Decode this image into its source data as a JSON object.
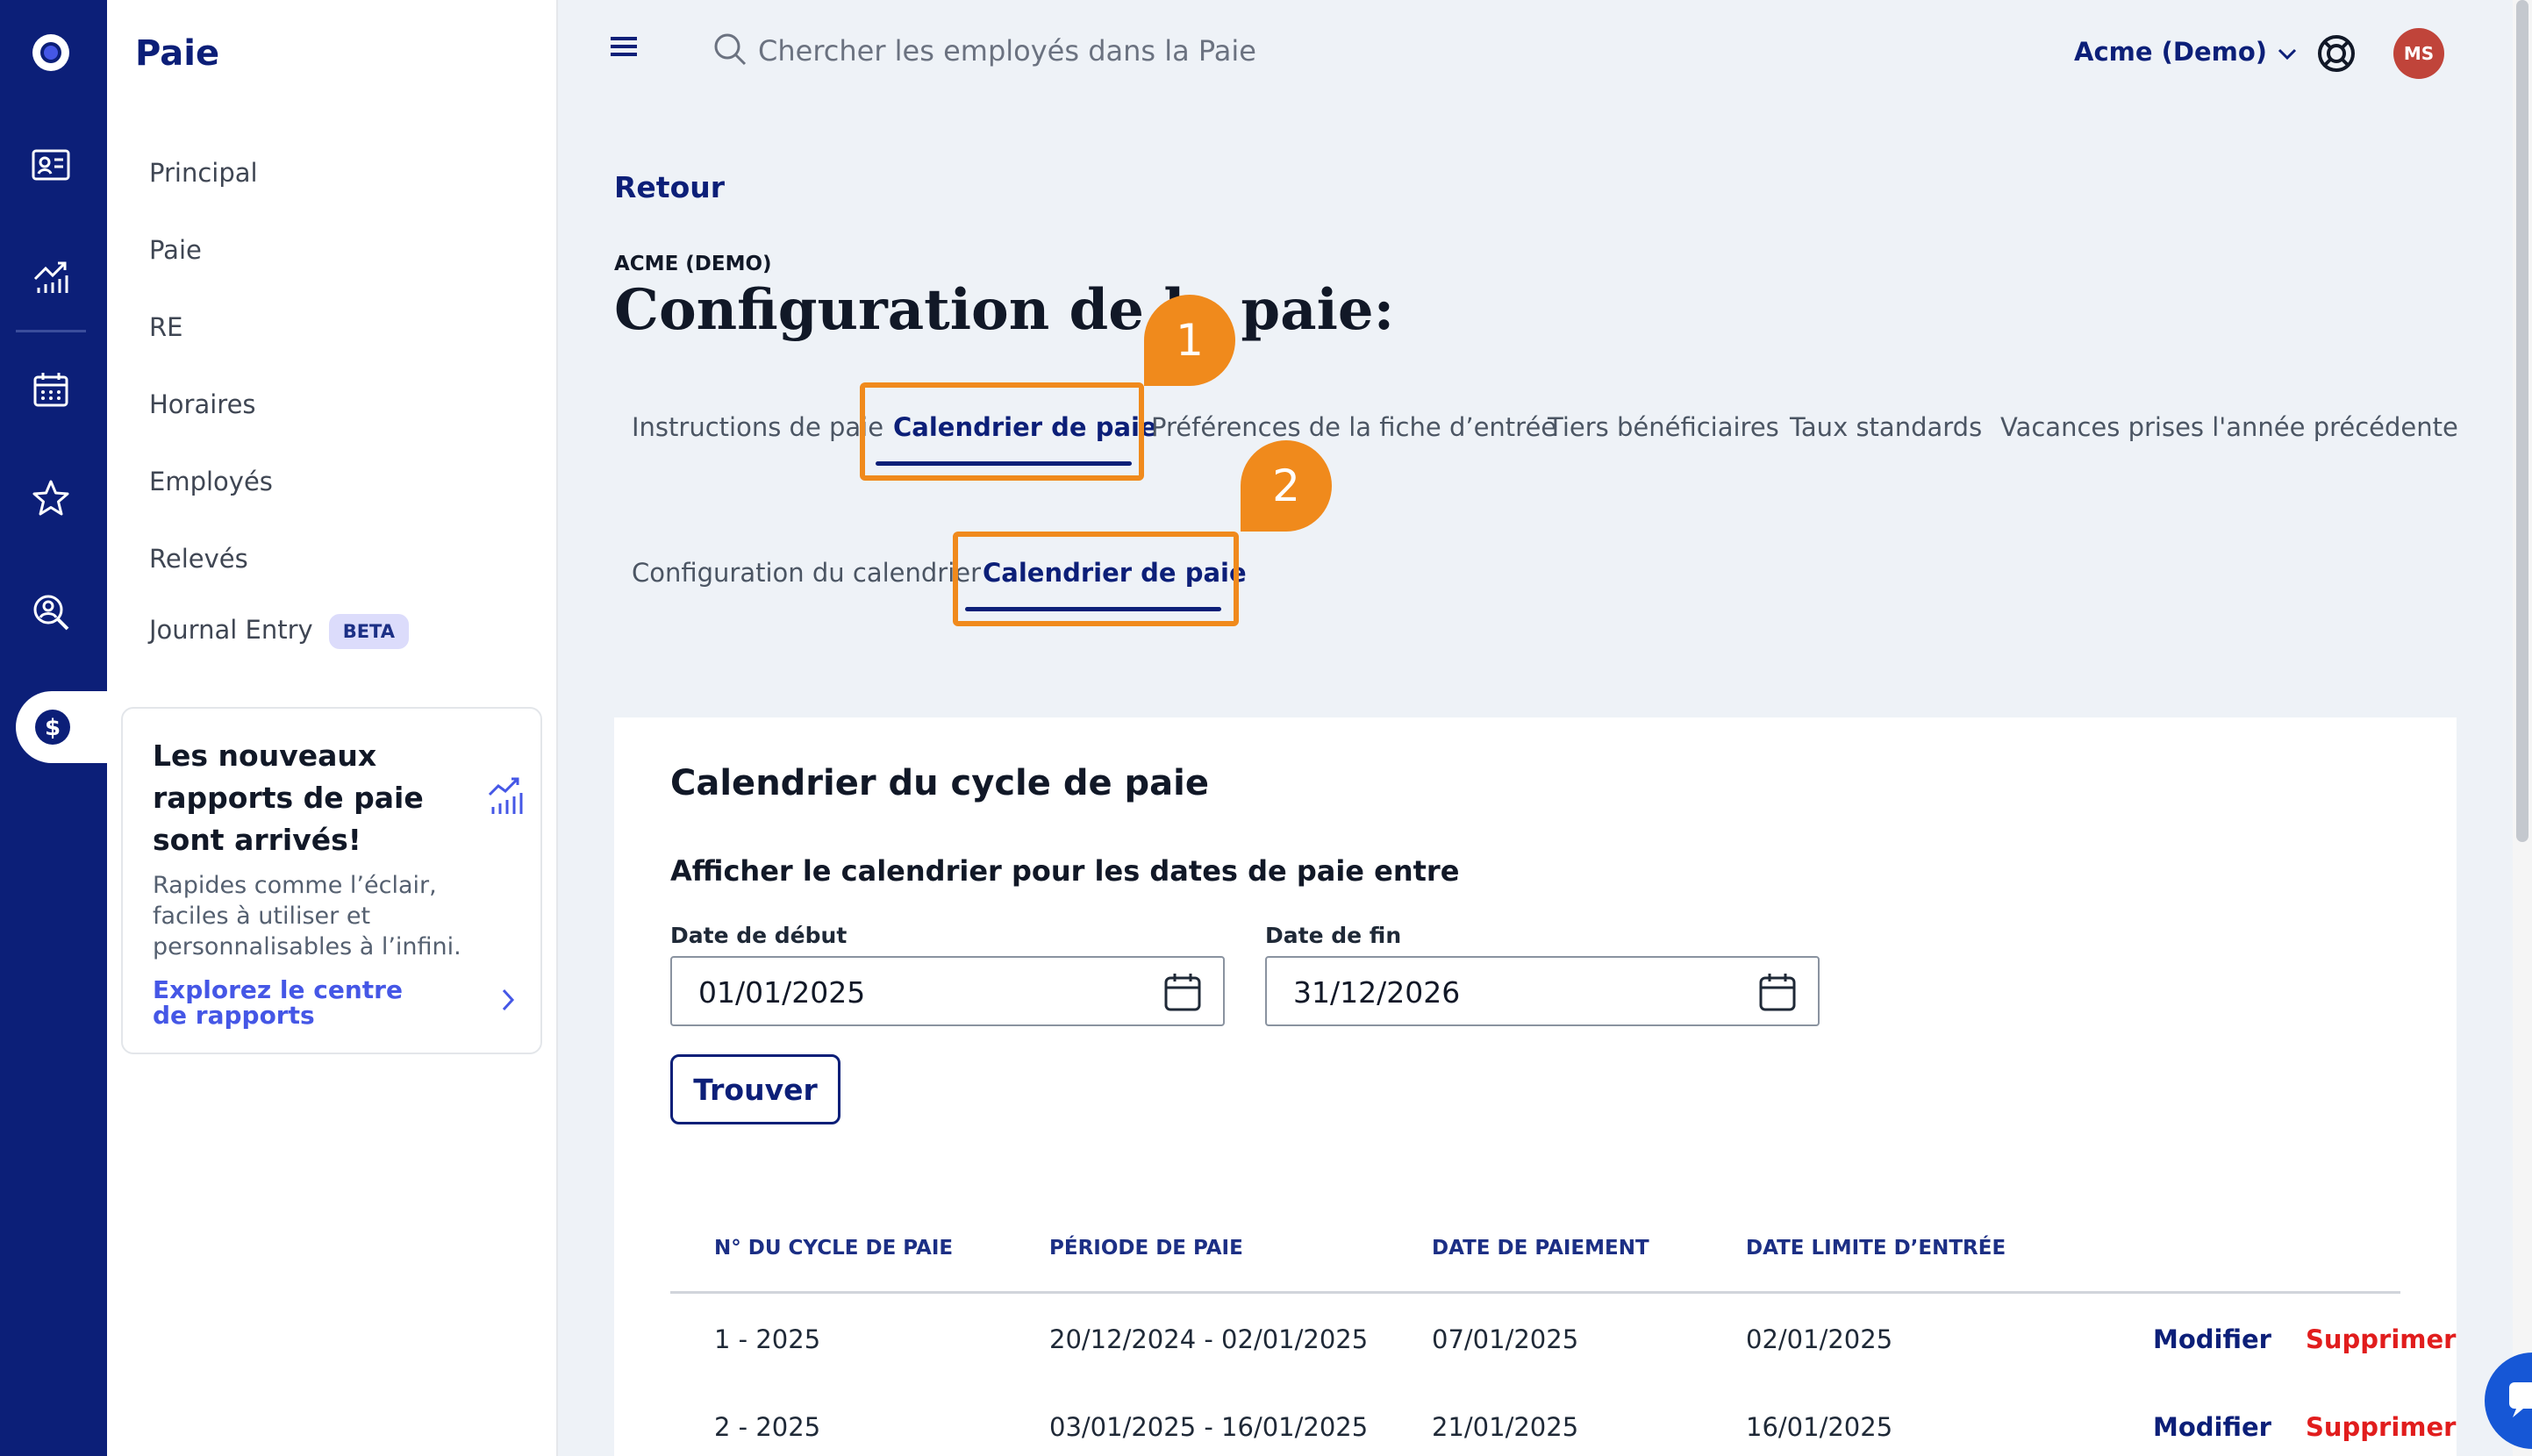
{
  "sidebar": {
    "title": "Paie",
    "items": [
      {
        "label": "Principal"
      },
      {
        "label": "Paie"
      },
      {
        "label": "RE"
      },
      {
        "label": "Horaires"
      },
      {
        "label": "Employés"
      },
      {
        "label": "Relevés"
      },
      {
        "label": "Journal Entry",
        "badge": "BETA"
      }
    ],
    "promo": {
      "title": "Les nouveaux rapports de paie sont arrivés!",
      "text": "Rapides comme l’éclair, faciles à utiliser et personnalisables à l’infini.",
      "link": "Explorez le centre de rapports"
    }
  },
  "rail": {
    "icons": [
      "logo-icon",
      "id-card-icon",
      "analytics-icon",
      "calendar-icon",
      "star-icon",
      "search-person-icon",
      "dollar-icon"
    ]
  },
  "topbar": {
    "search_placeholder": "Chercher les employés dans la Paie",
    "org": "Acme (Demo)",
    "avatar_initials": "MS"
  },
  "header": {
    "back": "Retour",
    "company": "ACME (DEMO)",
    "title": "Configuration de la paie:"
  },
  "tabs": [
    {
      "label": "Instructions de paie"
    },
    {
      "label": "Calendrier de paie",
      "active": true
    },
    {
      "label": "Préférences de la fiche d’entrée"
    },
    {
      "label": "Tiers bénéficiaires"
    },
    {
      "label": "Taux standards"
    },
    {
      "label": "Vacances prises l'année précédente"
    }
  ],
  "subtabs": [
    {
      "label": "Configuration du calendrier"
    },
    {
      "label": "Calendrier de paie",
      "active": true
    }
  ],
  "annotations": [
    "1",
    "2"
  ],
  "card": {
    "title": "Calendrier du cycle de paie",
    "subtitle": "Afficher le calendrier pour les dates de paie entre",
    "start_label": "Date de début",
    "start_value": "01/01/2025",
    "end_label": "Date de fin",
    "end_value": "31/12/2026",
    "find": "Trouver"
  },
  "table": {
    "headers": [
      "N° DU CYCLE DE PAIE",
      "PÉRIODE DE PAIE",
      "DATE DE PAIEMENT",
      "DATE LIMITE D’ENTRÉE"
    ],
    "rows": [
      {
        "cycle": "1 - 2025",
        "period": "20/12/2024 - 02/01/2025",
        "pay_date": "07/01/2025",
        "deadline": "02/01/2025",
        "edit": "Modifier",
        "delete": "Supprimer"
      },
      {
        "cycle": "2 - 2025",
        "period": "03/01/2025 - 16/01/2025",
        "pay_date": "21/01/2025",
        "deadline": "16/01/2025",
        "edit": "Modifier",
        "delete": "Supprimer"
      }
    ]
  },
  "colors": {
    "navy": "#0c1f78",
    "highlight": "#f08a1c",
    "delete": "#e11d1d",
    "link": "#4557e6"
  }
}
